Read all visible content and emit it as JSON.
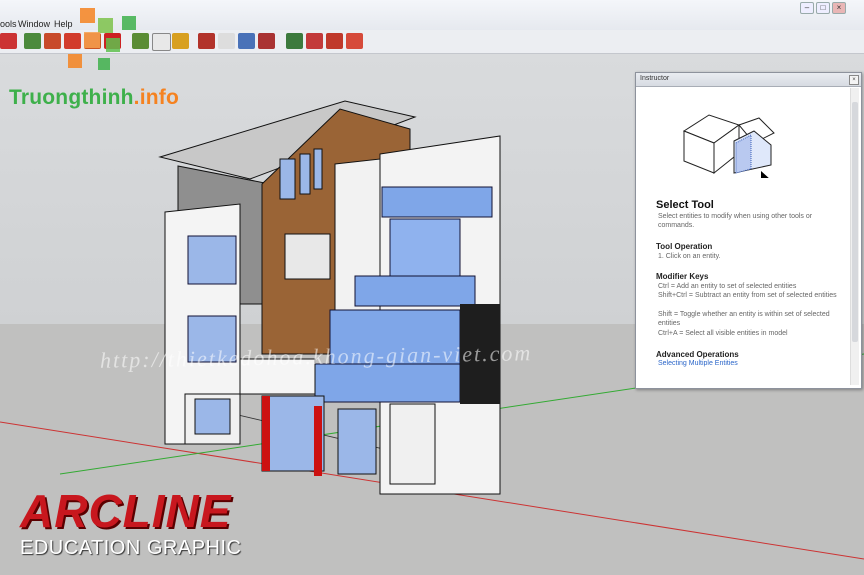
{
  "menu": [
    "ools",
    "Window",
    "Help"
  ],
  "window_controls": [
    "–",
    "□",
    "×"
  ],
  "instructor": {
    "title": "Instructor",
    "close": "×",
    "tool_title": "Select Tool",
    "tool_desc": "Select entities to modify when using other tools or commands.",
    "op_heading": "Tool Operation",
    "op_step": "1.  Click on an entity.",
    "mod_heading": "Modifier Keys",
    "mod_lines": [
      "Ctrl = Add an entity to set of selected entities",
      "Shift+Ctrl = Subtract an entity from set of selected entities",
      "Shift = Toggle whether an entity is within set of selected entities",
      "Ctrl+A = Select all visible entities in model"
    ],
    "adv_heading": "Advanced Operations",
    "adv_link": "Selecting Multiple Entities"
  },
  "watermark": "http://thietkedohoa.khong-gian-viet.com",
  "logo": {
    "brand": "Truongthinh",
    "tld": ".info"
  },
  "branding": {
    "title": "ARCLINE",
    "subtitle": "EDUCATION GRAPHIC"
  },
  "toolbar_icons": [
    "orbit-icon",
    "push-pull-icon",
    "rotate-icon",
    "move-icon",
    "follow-me-icon",
    "scale-icon",
    "tape-measure-icon",
    "text-icon",
    "paint-bucket-icon",
    "orbit-view-icon",
    "pan-icon",
    "zoom-icon",
    "zoom-extents-icon",
    "previous-view-icon",
    "next-view-icon",
    "add-location-icon",
    "get-models-icon",
    "share-model-icon"
  ],
  "colors": {
    "accent_red": "#c8171e",
    "glass_blue": "#7fa6e8",
    "wood_brown": "#9a6436",
    "axis_red": "#cc3333",
    "axis_green": "#33aa33"
  }
}
